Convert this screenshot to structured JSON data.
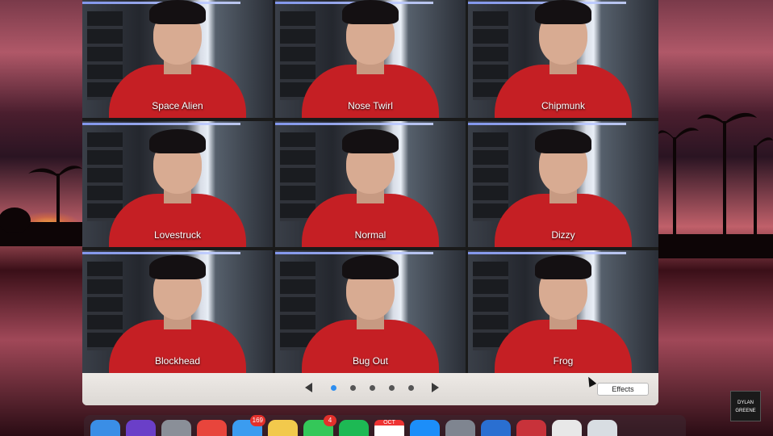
{
  "window": {
    "effects_grid": [
      {
        "label": "Space Alien"
      },
      {
        "label": "Nose Twirl"
      },
      {
        "label": "Chipmunk"
      },
      {
        "label": "Lovestruck"
      },
      {
        "label": "Normal"
      },
      {
        "label": "Dizzy"
      },
      {
        "label": "Blockhead"
      },
      {
        "label": "Bug Out"
      },
      {
        "label": "Frog"
      }
    ],
    "pager": {
      "pages": 5,
      "current_page": 1
    },
    "effects_button_label": "Effects"
  },
  "dock": {
    "items": [
      {
        "icon": "finder-icon",
        "color": "#3a8ee6"
      },
      {
        "icon": "siri-icon",
        "color": "#6a3fc8"
      },
      {
        "icon": "launchpad-icon",
        "color": "#8a8f98"
      },
      {
        "icon": "chrome-icon",
        "color": "#e8453c"
      },
      {
        "icon": "mail-icon",
        "color": "#3b9cf0",
        "badge": "169"
      },
      {
        "icon": "photos-icon",
        "color": "#f2c94c"
      },
      {
        "icon": "messages-icon",
        "color": "#34c759",
        "badge": "4"
      },
      {
        "icon": "spotify-icon",
        "color": "#1db954"
      },
      {
        "icon": "calendar-icon",
        "color": "#ffffff",
        "text": "OCT"
      },
      {
        "icon": "app-store-icon",
        "color": "#1c8ef9"
      },
      {
        "icon": "system-preferences-icon",
        "color": "#7f8590"
      },
      {
        "icon": "quicktime-icon",
        "color": "#2a6fd1"
      },
      {
        "icon": "photo-booth-icon",
        "color": "#c8323a"
      },
      {
        "icon": "document-icon",
        "color": "#e8e8e8"
      },
      {
        "icon": "trash-icon",
        "color": "#d8dde2"
      }
    ]
  },
  "watermark": {
    "text": "DYLAN GREENE"
  },
  "colors": {
    "hoodie": "#c51f24",
    "pager_active": "#2e8ef0"
  }
}
